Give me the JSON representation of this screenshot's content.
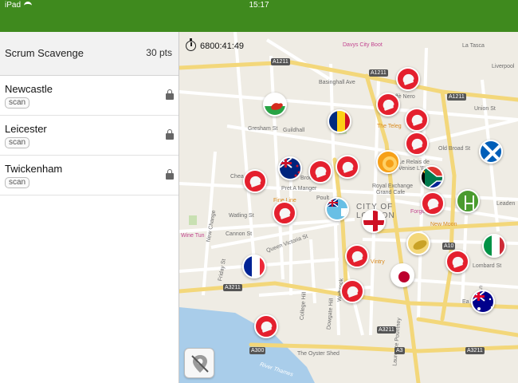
{
  "status_bar": {
    "carrier": "iPad",
    "time": "15:17"
  },
  "sidebar": {
    "title": "Scrum Scavenge",
    "points": "30 pts",
    "items": [
      {
        "title": "Newcastle",
        "tag": "scan",
        "locked": true
      },
      {
        "title": "Leicester",
        "tag": "scan",
        "locked": true
      },
      {
        "title": "Twickenham",
        "tag": "scan",
        "locked": true
      }
    ]
  },
  "map": {
    "timer": "6800:41:49",
    "labels": {
      "davys": "Davys City Boot",
      "basinghall": "Basinghall Ave",
      "la_tasca": "La Tasca",
      "liverpool": "Liverpool",
      "caffe_nero": "Caffè Nero",
      "guildhall": "Guildhall",
      "gresham": "Gresham St",
      "teleg": "The Teleg",
      "old_broad": "Old Broad St",
      "relais": "Le Relais de",
      "entrecote": "Venise L'Ent",
      "royal_exchange": "Royal Exchange",
      "grand_cafe": "Grand Cafe",
      "pret": "Pret A Manger",
      "brow": "Brow",
      "fine_line": "Fine Line",
      "city_of": "CITY OF",
      "london": "LONDON",
      "forge": "Forge",
      "new_moon": "New Moon",
      "watling": "Watling St",
      "cannon": "Cannon St",
      "queen_victoria": "Queen Victoria St",
      "wine_tun": "Wine Tun",
      "vintry": "Vintry",
      "oyster_shed": "The Oyster Shed",
      "river_thames": "River Thames",
      "friday": "Friday St",
      "new_change": "New Change",
      "college_hill": "College Hill",
      "dowgate_hill": "Dowgate Hill",
      "walbrook": "Walbrook",
      "laurence": "Laurence Pountney",
      "philpot": "Philpot Ln",
      "lombard": "Lombard St",
      "poultry": "Poult",
      "cheapside": "Chea",
      "leadenhall": "Leaden",
      "ea": "Ea",
      "union": "Union St"
    },
    "roads": {
      "a1211_top": "A1211",
      "a1211_mid": "A1211",
      "a1211_right": "A1211",
      "a10": "A10",
      "a3211_left": "A3211",
      "a3211_mid": "A3211",
      "a3211_right": "A3211",
      "a300": "A300",
      "a3": "A3"
    },
    "flags": [
      "Wales",
      "Romania",
      "New Zealand",
      "South Africa",
      "Scotland",
      "Italy",
      "France",
      "Fiji",
      "England",
      "Japan",
      "Australia"
    ],
    "colors": {
      "header_green": "#3f8a1e",
      "pin_red": "#e4202e",
      "road_yellow": "#f7df8a",
      "water": "#a9cdea",
      "park": "#c8e0b2"
    }
  }
}
